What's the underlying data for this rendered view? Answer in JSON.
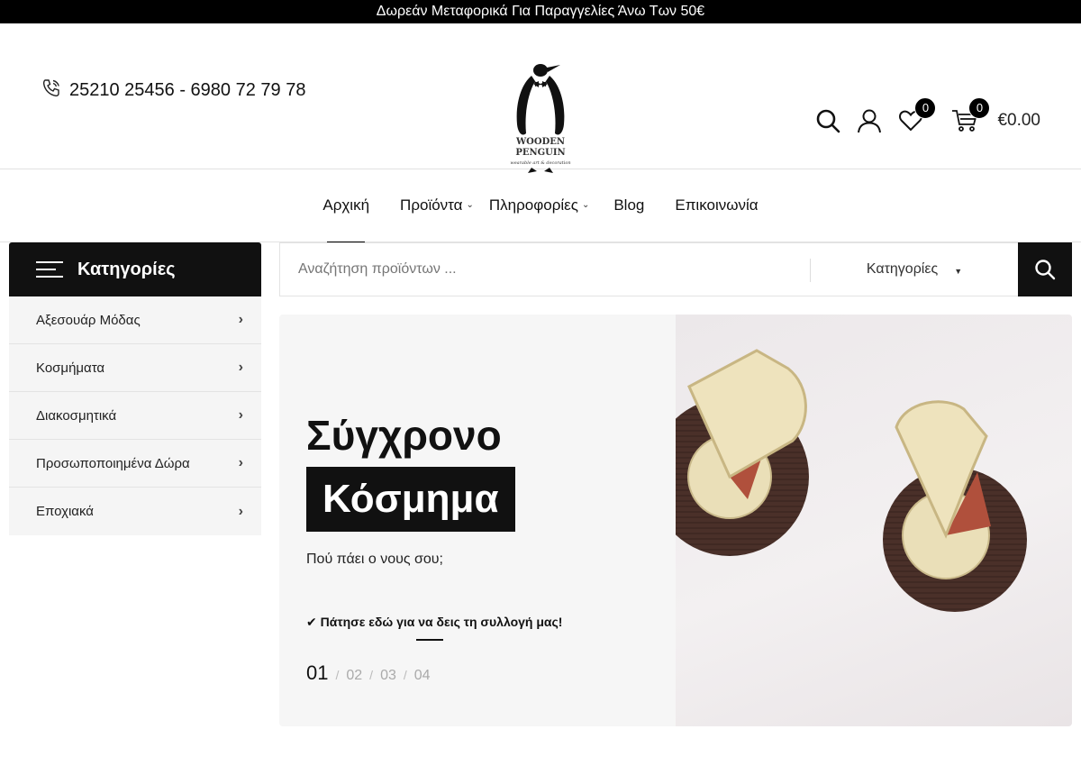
{
  "topbar": {
    "text": "Δωρεάν Μεταφορικά Για Παραγγελίες Άνω Των 50€"
  },
  "header": {
    "phone": "25210 25456 - 6980 72 79 78",
    "logo": {
      "line1": "WOODEN",
      "line2": "PENGUIN",
      "line3": "wearable art & decoration"
    },
    "wishlist_count": "0",
    "cart_count": "0",
    "cart_total": "€0.00"
  },
  "nav": {
    "items": [
      {
        "label": "Αρχική"
      },
      {
        "label": "Προϊόντα"
      },
      {
        "label": "Πληροφορίες"
      },
      {
        "label": "Blog"
      },
      {
        "label": "Επικοινωνία"
      }
    ]
  },
  "categories": {
    "title": "Κατηγορίες",
    "items": [
      {
        "label": "Αξεσουάρ Μόδας"
      },
      {
        "label": "Κοσμήματα"
      },
      {
        "label": "Διακοσμητικά"
      },
      {
        "label": "Προσωποποιημένα Δώρα"
      },
      {
        "label": "Εποχιακά"
      }
    ]
  },
  "search": {
    "placeholder": "Αναζήτηση προϊόντων ...",
    "category_label": "Κατηγορίες"
  },
  "hero": {
    "title_line1": "Σύγχρονο",
    "title_line2": "Κόσμημα",
    "subtitle": "Πού πάει ο νους σου;",
    "cta": "✔ Πάτησε εδώ για να δεις τη συλλογή μας!",
    "pages": [
      "01",
      "02",
      "03",
      "04"
    ]
  },
  "colors": {
    "accent": "#000000",
    "panel": "#f5f5f5"
  }
}
